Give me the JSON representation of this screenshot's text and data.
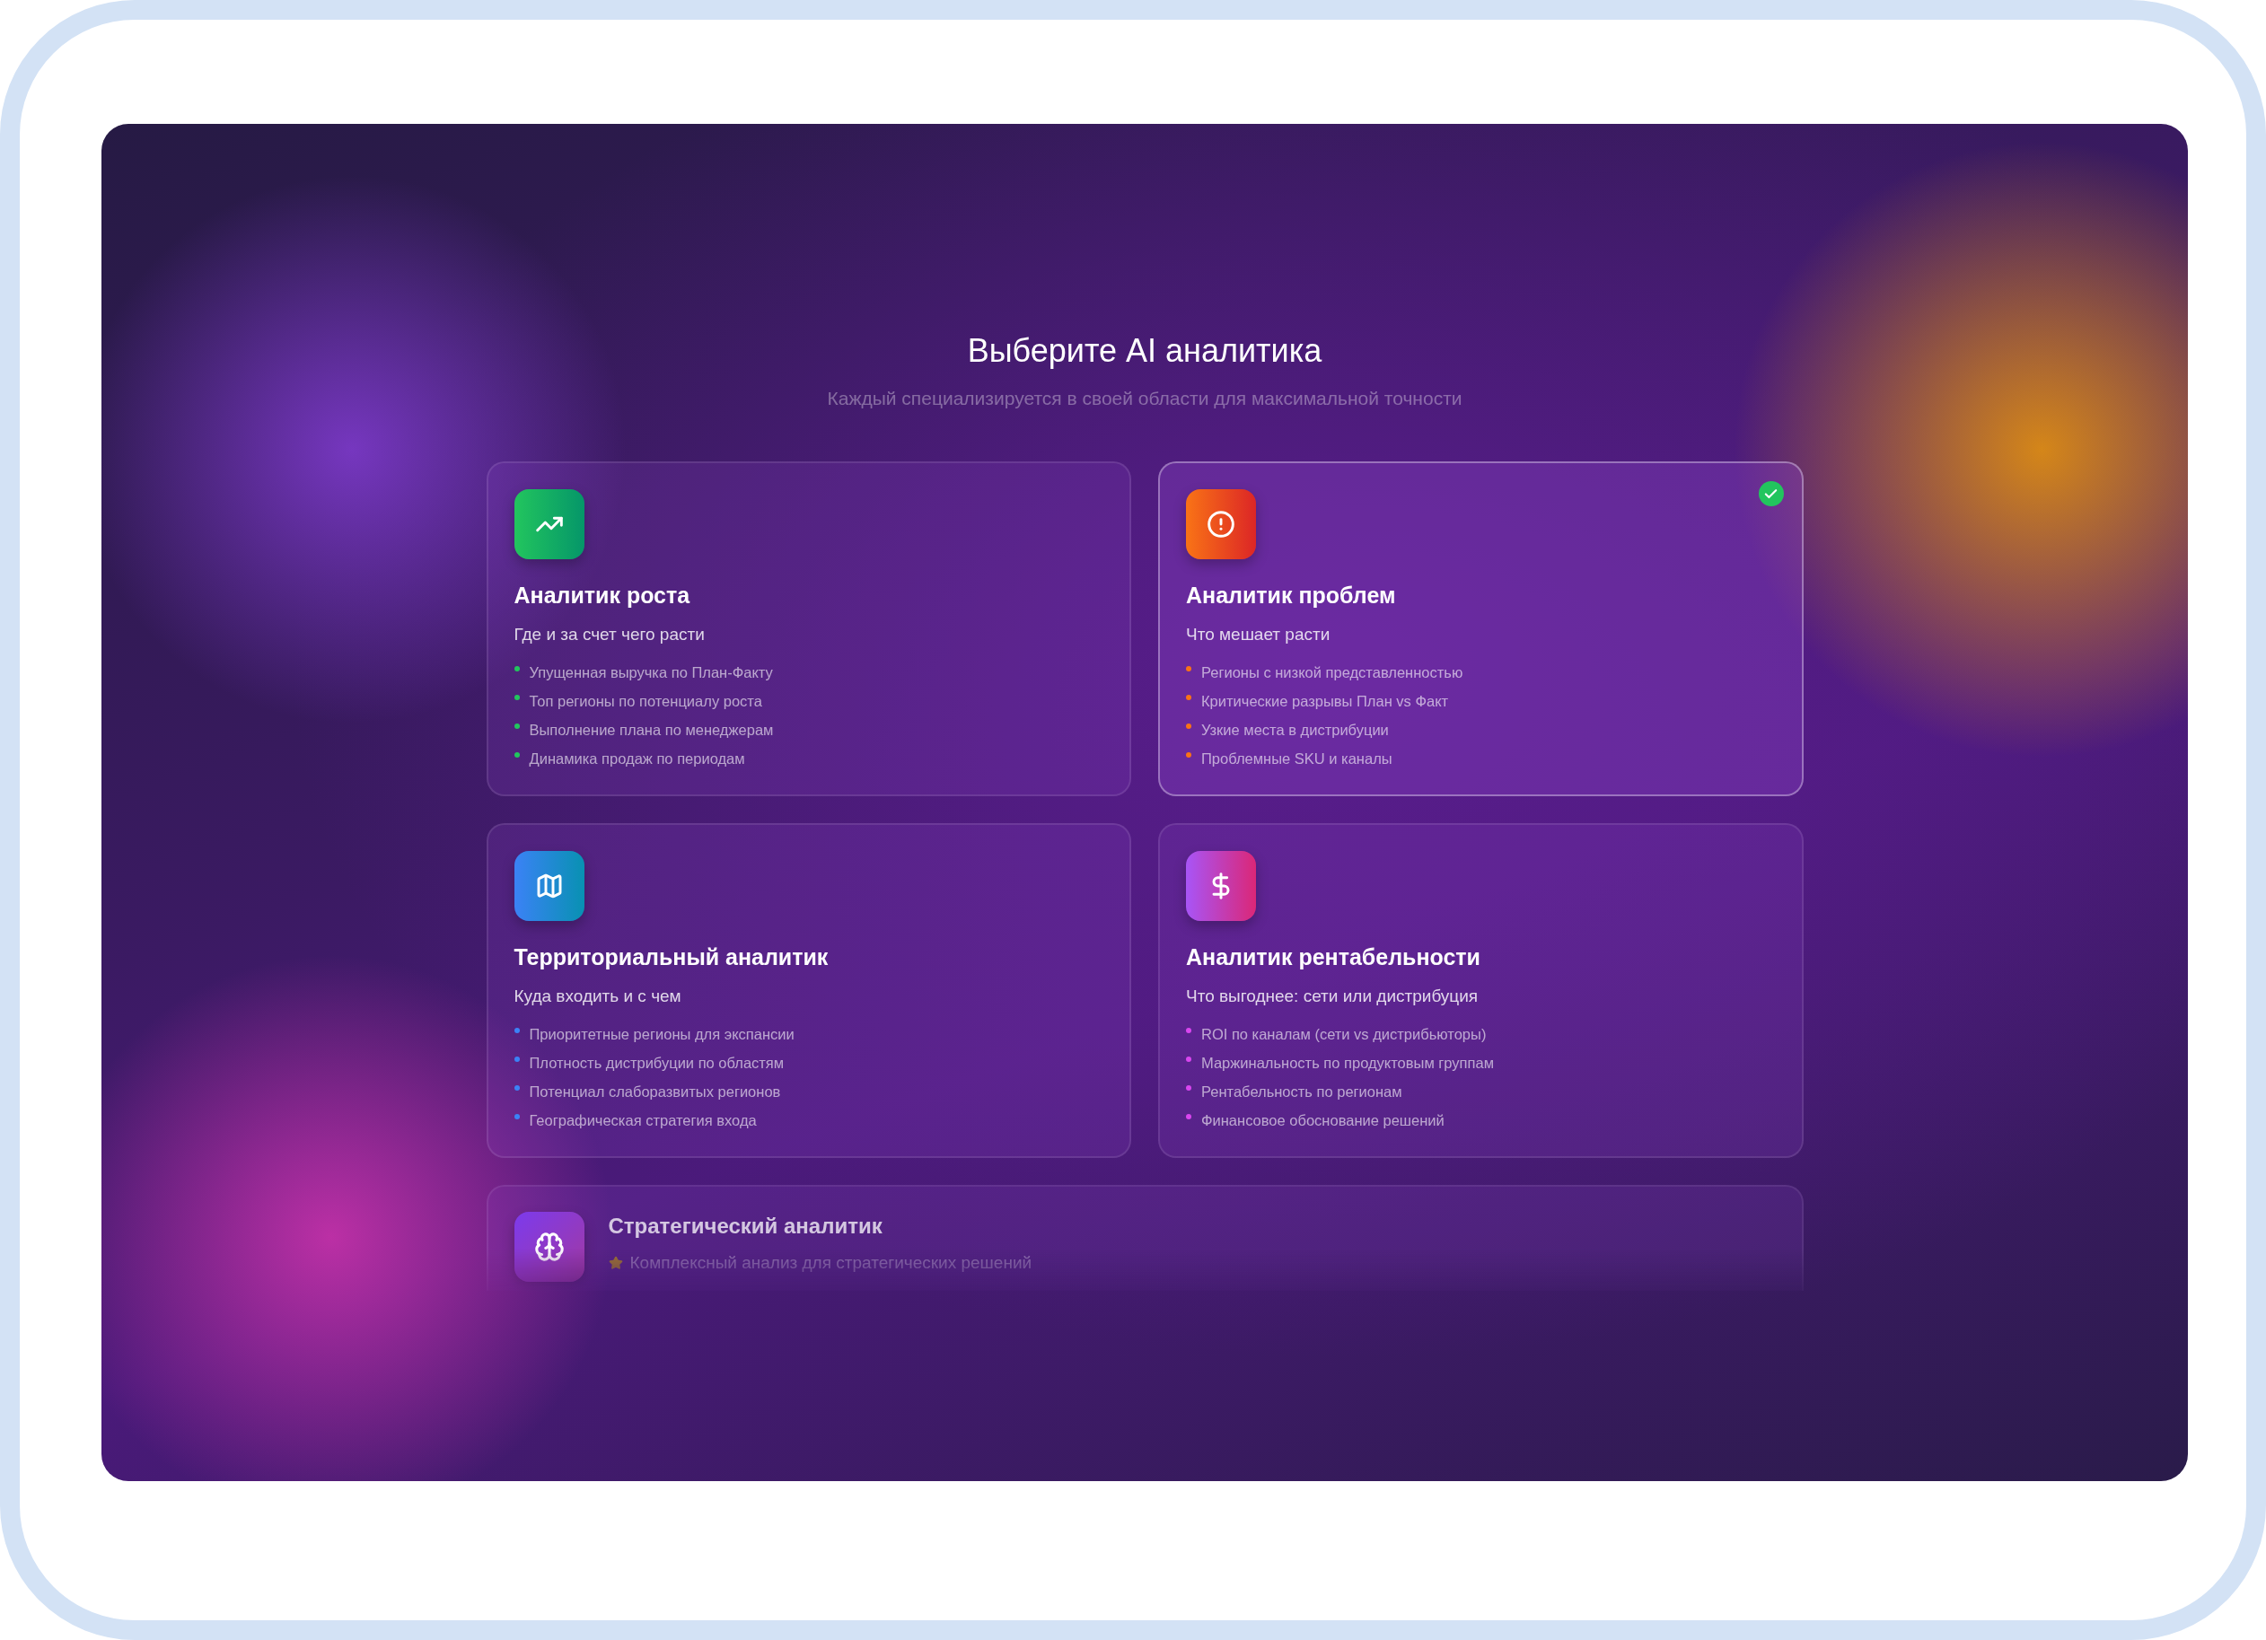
{
  "header": {
    "title": "Выберите AI аналитика",
    "subtitle": "Каждый специализируется в своей области для максимальной точности"
  },
  "analysts": [
    {
      "kind": "trend",
      "color": "#22c55e",
      "selected": false,
      "title": "Аналитик роста",
      "subtitle": "Где и за счет чего расти",
      "points": [
        "Упущенная выручка по План-Факту",
        "Топ регионы по потенциалу роста",
        "Выполнение плана по менеджерам",
        "Динамика продаж по периодам"
      ]
    },
    {
      "kind": "alert",
      "color": "#f97316",
      "selected": true,
      "title": "Аналитик проблем",
      "subtitle": "Что мешает расти",
      "points": [
        "Регионы с низкой представленностью",
        "Критические разрывы План vs Факт",
        "Узкие места в дистрибуции",
        "Проблемные SKU и каналы"
      ]
    },
    {
      "kind": "map",
      "color": "#3b82f6",
      "selected": false,
      "title": "Территориальный аналитик",
      "subtitle": "Куда входить и с чем",
      "points": [
        "Приоритетные регионы для экспансии",
        "Плотность дистрибуции по областям",
        "Потенциал слаборазвитых регионов",
        "Географическая стратегия входа"
      ]
    },
    {
      "kind": "dollar",
      "color": "#d946ef",
      "selected": false,
      "title": "Аналитик рентабельности",
      "subtitle": "Что выгоднее: сети или дистрибуция",
      "points": [
        "ROI по каналам (сети vs дистрибьюторы)",
        "Маржинальность по продуктовым группам",
        "Рентабельность по регионам",
        "Финансовое обоснование решений"
      ]
    }
  ],
  "featured": {
    "kind": "brain",
    "selected": false,
    "title": "Стратегический аналитик",
    "subtitle": "Комплексный анализ для стратегических решений"
  }
}
